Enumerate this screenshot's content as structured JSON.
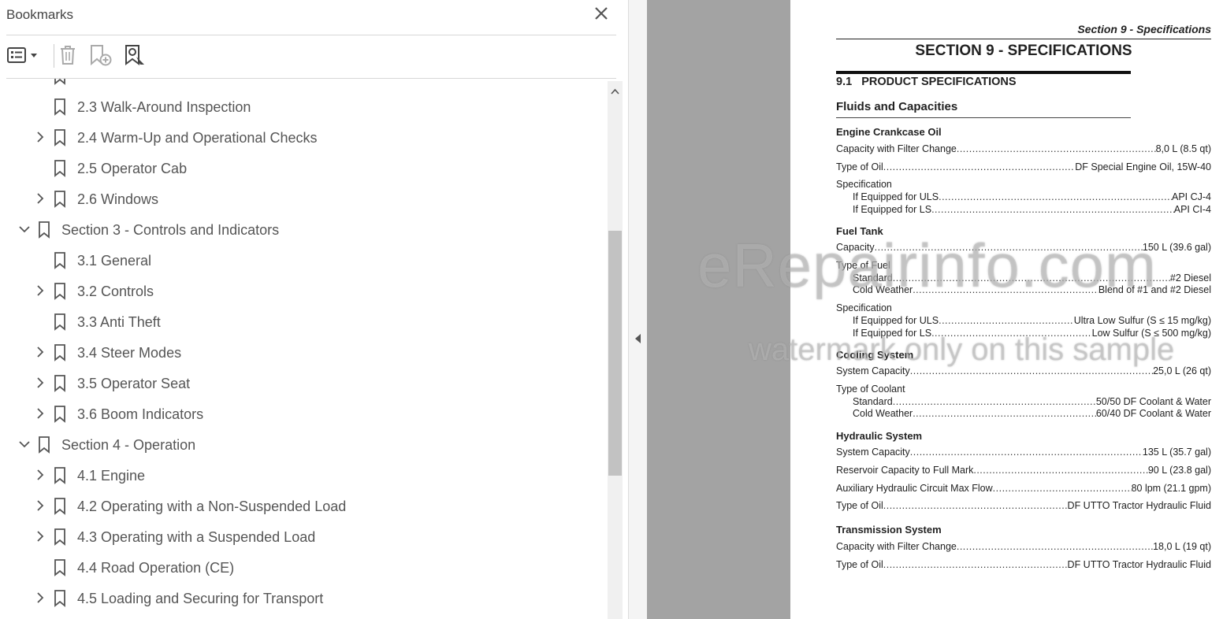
{
  "panel": {
    "title": "Bookmarks"
  },
  "toolbar": {
    "options_icon": "list-options-icon",
    "delete_icon": "trash-icon",
    "add_icon": "add-bookmark-icon",
    "find_icon": "find-bookmark-icon"
  },
  "tree": [
    {
      "label": "2.3 Walk-Around Inspection",
      "level": 2,
      "expandable": false,
      "expanded": false
    },
    {
      "label": "2.4 Warm-Up and Operational Checks",
      "level": 2,
      "expandable": true,
      "expanded": false
    },
    {
      "label": "2.5 Operator Cab",
      "level": 2,
      "expandable": false,
      "expanded": false
    },
    {
      "label": "2.6 Windows",
      "level": 2,
      "expandable": true,
      "expanded": false
    },
    {
      "label": "Section 3 - Controls and Indicators",
      "level": 1,
      "expandable": true,
      "expanded": true
    },
    {
      "label": "3.1 General",
      "level": 2,
      "expandable": false,
      "expanded": false
    },
    {
      "label": "3.2 Controls",
      "level": 2,
      "expandable": true,
      "expanded": false
    },
    {
      "label": "3.3 Anti Theft",
      "level": 2,
      "expandable": false,
      "expanded": false
    },
    {
      "label": "3.4 Steer Modes",
      "level": 2,
      "expandable": true,
      "expanded": false
    },
    {
      "label": "3.5 Operator Seat",
      "level": 2,
      "expandable": true,
      "expanded": false
    },
    {
      "label": "3.6 Boom Indicators",
      "level": 2,
      "expandable": true,
      "expanded": false
    },
    {
      "label": "Section 4 - Operation",
      "level": 1,
      "expandable": true,
      "expanded": true
    },
    {
      "label": "4.1 Engine",
      "level": 2,
      "expandable": true,
      "expanded": false
    },
    {
      "label": "4.2 Operating with a Non-Suspended Load",
      "level": 2,
      "expandable": true,
      "expanded": false
    },
    {
      "label": "4.3 Operating with a Suspended Load",
      "level": 2,
      "expandable": true,
      "expanded": false
    },
    {
      "label": "4.4 Road Operation (CE)",
      "level": 2,
      "expandable": false,
      "expanded": false
    },
    {
      "label": "4.5 Loading and Securing for Transport",
      "level": 2,
      "expandable": true,
      "expanded": false
    }
  ],
  "document": {
    "running_head": "Section 9 - Specifications",
    "title": "SECTION 9 - SPECIFICATIONS",
    "subheading_num": "9.1",
    "subheading": "PRODUCT SPECIFICATIONS",
    "fluids_heading": "Fluids and Capacities",
    "engine_oil": {
      "heading": "Engine Crankcase Oil",
      "capacity_label": "Capacity with Filter Change",
      "capacity_value": "8,0 L (8.5 qt)",
      "type_label": "Type of Oil",
      "type_value": "DF Special Engine Oil, 15W-40",
      "spec_label": "Specification",
      "uls_label": "If Equipped for ULS",
      "uls_value": "API CJ-4",
      "ls_label": "If Equipped for LS",
      "ls_value": "API CI-4"
    },
    "fuel": {
      "heading": "Fuel Tank",
      "capacity_label": "Capacity",
      "capacity_value": "150 L (39.6 gal)",
      "type_label": "Type of Fuel",
      "standard_label": "Standard",
      "standard_value": "#2 Diesel",
      "cold_label": "Cold Weather",
      "cold_value": "Blend of #1 and #2 Diesel",
      "spec_label": "Specification",
      "uls_label": "If Equipped for ULS",
      "uls_value": "Ultra Low Sulfur (S ≤ 15 mg/kg)",
      "ls_label": "If Equipped for LS",
      "ls_value": "Low Sulfur (S ≤ 500 mg/kg)"
    },
    "cooling": {
      "heading": "Cooling System",
      "capacity_label": "System Capacity",
      "capacity_value": "25,0 L (26 qt)",
      "type_label": "Type of Coolant",
      "standard_label": "Standard",
      "standard_value": "50/50 DF Coolant & Water",
      "cold_label": "Cold Weather",
      "cold_value": "60/40 DF Coolant & Water"
    },
    "hydraulic": {
      "heading": "Hydraulic System",
      "capacity_label": "System Capacity",
      "capacity_value": "135 L (35.7 gal)",
      "reservoir_label": "Reservoir Capacity to Full Mark",
      "reservoir_value": "90 L (23.8 gal)",
      "aux_label": "Auxiliary Hydraulic Circuit Max Flow",
      "aux_value": "80 lpm (21.1 gpm)",
      "type_label": "Type of Oil",
      "type_value": "DF UTTO Tractor Hydraulic Fluid"
    },
    "transmission": {
      "heading": "Transmission System",
      "capacity_label": "Capacity with Filter Change",
      "capacity_value": "18,0 L (19 qt)",
      "type_label": "Type of Oil",
      "type_value": "DF UTTO Tractor Hydraulic Fluid"
    }
  },
  "watermark": {
    "line1": "eRepairinfo.com",
    "line2": "watermark only on this sample"
  }
}
